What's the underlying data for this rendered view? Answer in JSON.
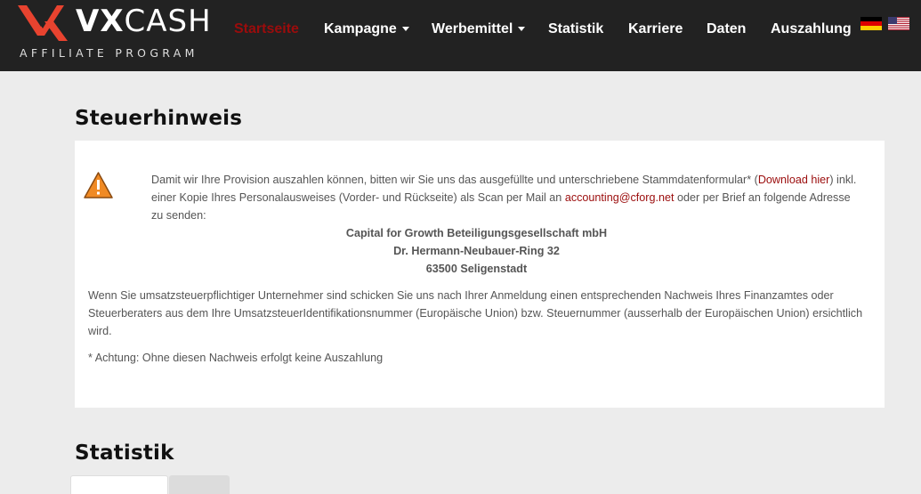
{
  "brand": {
    "name_bold": "VX",
    "name_light": "CASH",
    "tagline": "AFFILIATE PROGRAM",
    "accent_color": "#e8432f"
  },
  "nav": {
    "items": [
      {
        "label": "Startseite",
        "active": true
      },
      {
        "label": "Kampagne",
        "dropdown": true
      },
      {
        "label": "Werbemittel",
        "dropdown": true
      },
      {
        "label": "Statistik"
      },
      {
        "label": "Karriere"
      },
      {
        "label": "Daten"
      },
      {
        "label": "Auszahlung"
      }
    ],
    "languages": [
      "de-flag-icon",
      "us-flag-icon"
    ]
  },
  "tax_notice": {
    "title": "Steuerhinweis",
    "intro_before_link": "Damit wir Ihre Provision auszahlen können, bitten wir Sie uns das ausgefüllte und unterschriebene Stammdatenformular* (",
    "download_link": "Download hier",
    "intro_after_link": ") inkl. einer Kopie Ihres Personalausweises (Vorder- und Rückseite) als Scan per Mail an ",
    "email": "accounting@cforg.net",
    "intro_end": " oder per Brief an folgende Adresse zu senden:",
    "address": [
      "Capital for Growth Beteiligungsgesellschaft mbH",
      "Dr. Hermann-Neubauer-Ring 32",
      "63500 Seligenstadt"
    ],
    "vat_text": "Wenn Sie umsatzsteuerpflichtiger Unternehmer sind schicken Sie uns nach Ihrer Anmeldung einen entsprechenden Nachweis Ihres Finanzamtes oder Steuerberaters aus dem Ihre UmsatzsteuerIdentifikationsnummer (Europäische Union) bzw. Steuernummer (ausserhalb der Europäischen Union) ersichtlich wird.",
    "footnote": "* Achtung: Ohne diesen Nachweis erfolgt keine Auszahlung",
    "link_color": "#9b0c0c"
  },
  "statistik": {
    "title": "Statistik"
  }
}
